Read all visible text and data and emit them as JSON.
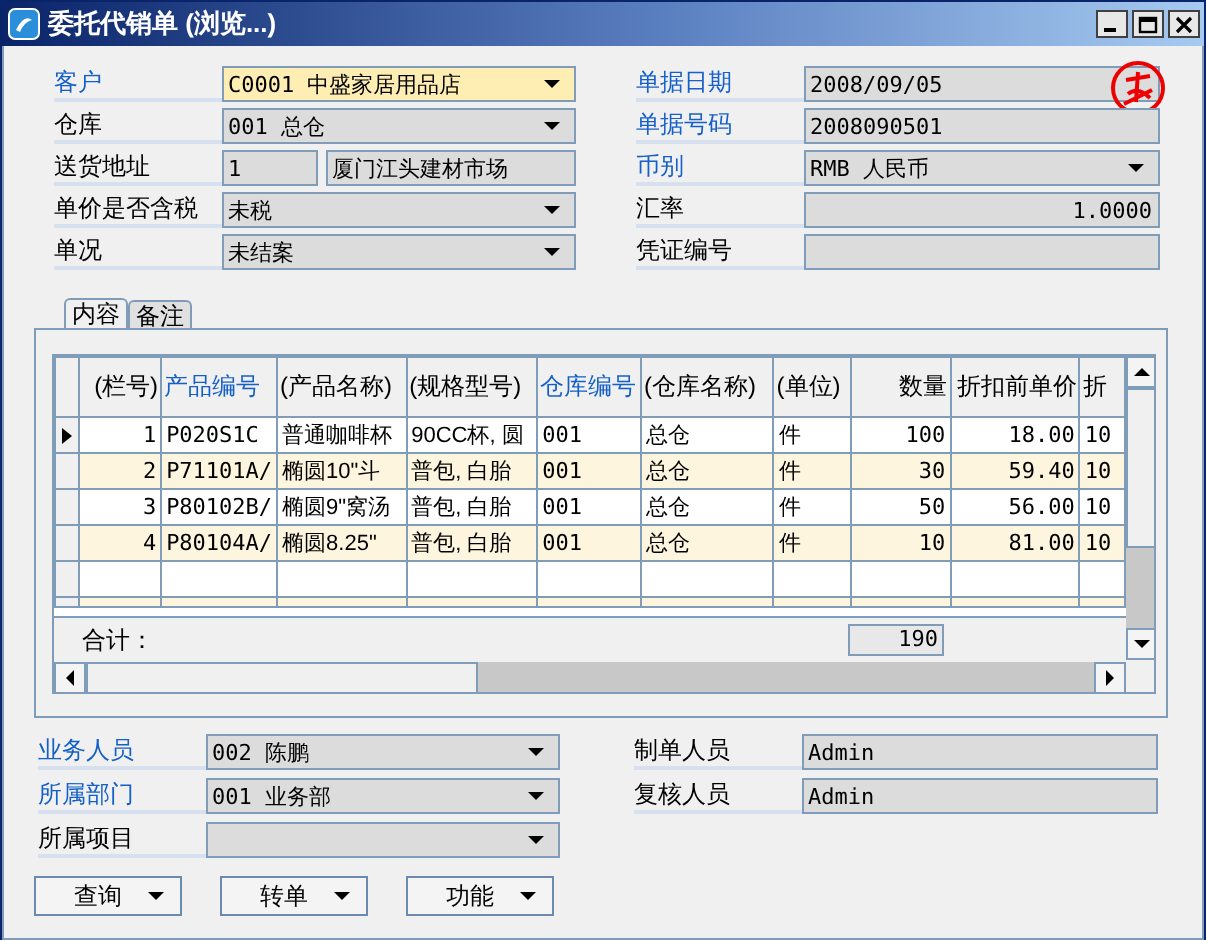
{
  "window": {
    "title": "委托代销单 (浏览...)"
  },
  "header_fields": {
    "left": [
      {
        "label": "客户",
        "required": true,
        "kind": "combo",
        "value": "C0001  中盛家居用品店",
        "focused": true
      },
      {
        "label": "仓库",
        "required": false,
        "kind": "combo",
        "value": "001  总仓",
        "focused": false
      },
      {
        "label": "送货地址",
        "required": false,
        "kind": "split",
        "value": "1",
        "value_2": "厦门江头建材市场",
        "focused": false
      },
      {
        "label": "单价是否含税",
        "required": false,
        "kind": "combo",
        "value": "未税",
        "focused": false
      },
      {
        "label": "单况",
        "required": false,
        "kind": "combo",
        "value": "未结案",
        "focused": false
      }
    ],
    "right": [
      {
        "label": "单据日期",
        "required": true,
        "kind": "date",
        "value": "2008/09/05",
        "focused": false
      },
      {
        "label": "单据号码",
        "required": true,
        "kind": "text",
        "value": "2008090501",
        "focused": false
      },
      {
        "label": "币别",
        "required": true,
        "kind": "combo",
        "value": "RMB  人民币",
        "focused": false
      },
      {
        "label": "汇率",
        "required": false,
        "kind": "number",
        "value": "1.0000",
        "focused": false
      },
      {
        "label": "凭证编号",
        "required": false,
        "kind": "text",
        "focused": false
      }
    ]
  },
  "tabs": [
    {
      "label": "内容",
      "selected": true
    },
    {
      "label": "备注",
      "selected": false
    }
  ],
  "table": {
    "columns": [
      {
        "label": "(栏号)",
        "required": false,
        "kind": "number"
      },
      {
        "label": "产品编号",
        "required": true,
        "kind": "text"
      },
      {
        "label": "(产品名称)",
        "required": false,
        "kind": "text"
      },
      {
        "label": "(规格型号)",
        "required": false,
        "kind": "text"
      },
      {
        "label": "仓库编号",
        "required": true,
        "kind": "text"
      },
      {
        "label": "(仓库名称)",
        "required": false,
        "kind": "text"
      },
      {
        "label": "(单位)",
        "required": false,
        "kind": "text"
      },
      {
        "label": "数量",
        "required": false,
        "kind": "number"
      },
      {
        "label": "折扣前单价",
        "required": false,
        "kind": "number"
      },
      {
        "label": "折",
        "required": false,
        "kind": "text"
      }
    ],
    "rows": [
      {
        "selected": true,
        "cells": [
          "1",
          "P020S1C",
          "普通咖啡杯",
          "90CC杯, 圆",
          "001",
          "总仓",
          "件",
          "100",
          "18.00",
          "10"
        ]
      },
      {
        "selected": false,
        "cells": [
          "2",
          "P71101A/",
          "椭圆10\"斗",
          "普包, 白胎",
          "001",
          "总仓",
          "件",
          "30",
          "59.40",
          "10"
        ]
      },
      {
        "selected": false,
        "cells": [
          "3",
          "P80102B/",
          "椭圆9\"窝汤",
          "普包, 白胎",
          "001",
          "总仓",
          "件",
          "50",
          "56.00",
          "10"
        ]
      },
      {
        "selected": false,
        "cells": [
          "4",
          "P80104A/",
          "椭圆8.25\"",
          "普包, 白胎",
          "001",
          "总仓",
          "件",
          "10",
          "81.00",
          "10"
        ]
      }
    ],
    "total": {
      "label": "合计：",
      "value": "190"
    }
  },
  "footer_fields": {
    "left": [
      {
        "label": "业务人员",
        "required": true,
        "kind": "combo",
        "value": "002  陈鹏",
        "focused": false
      },
      {
        "label": "所属部门",
        "required": true,
        "kind": "combo",
        "value": "001  业务部",
        "focused": false
      },
      {
        "label": "所属项目",
        "required": false,
        "kind": "combo",
        "focused": false
      }
    ],
    "right": [
      {
        "label": "制单人员",
        "required": false,
        "kind": "text",
        "value": "Admin",
        "focused": false
      },
      {
        "label": "复核人员",
        "required": false,
        "kind": "text",
        "value": "Admin",
        "focused": false
      }
    ]
  },
  "buttons": [
    {
      "label": "查询"
    },
    {
      "label": "转单"
    },
    {
      "label": "功能"
    }
  ]
}
